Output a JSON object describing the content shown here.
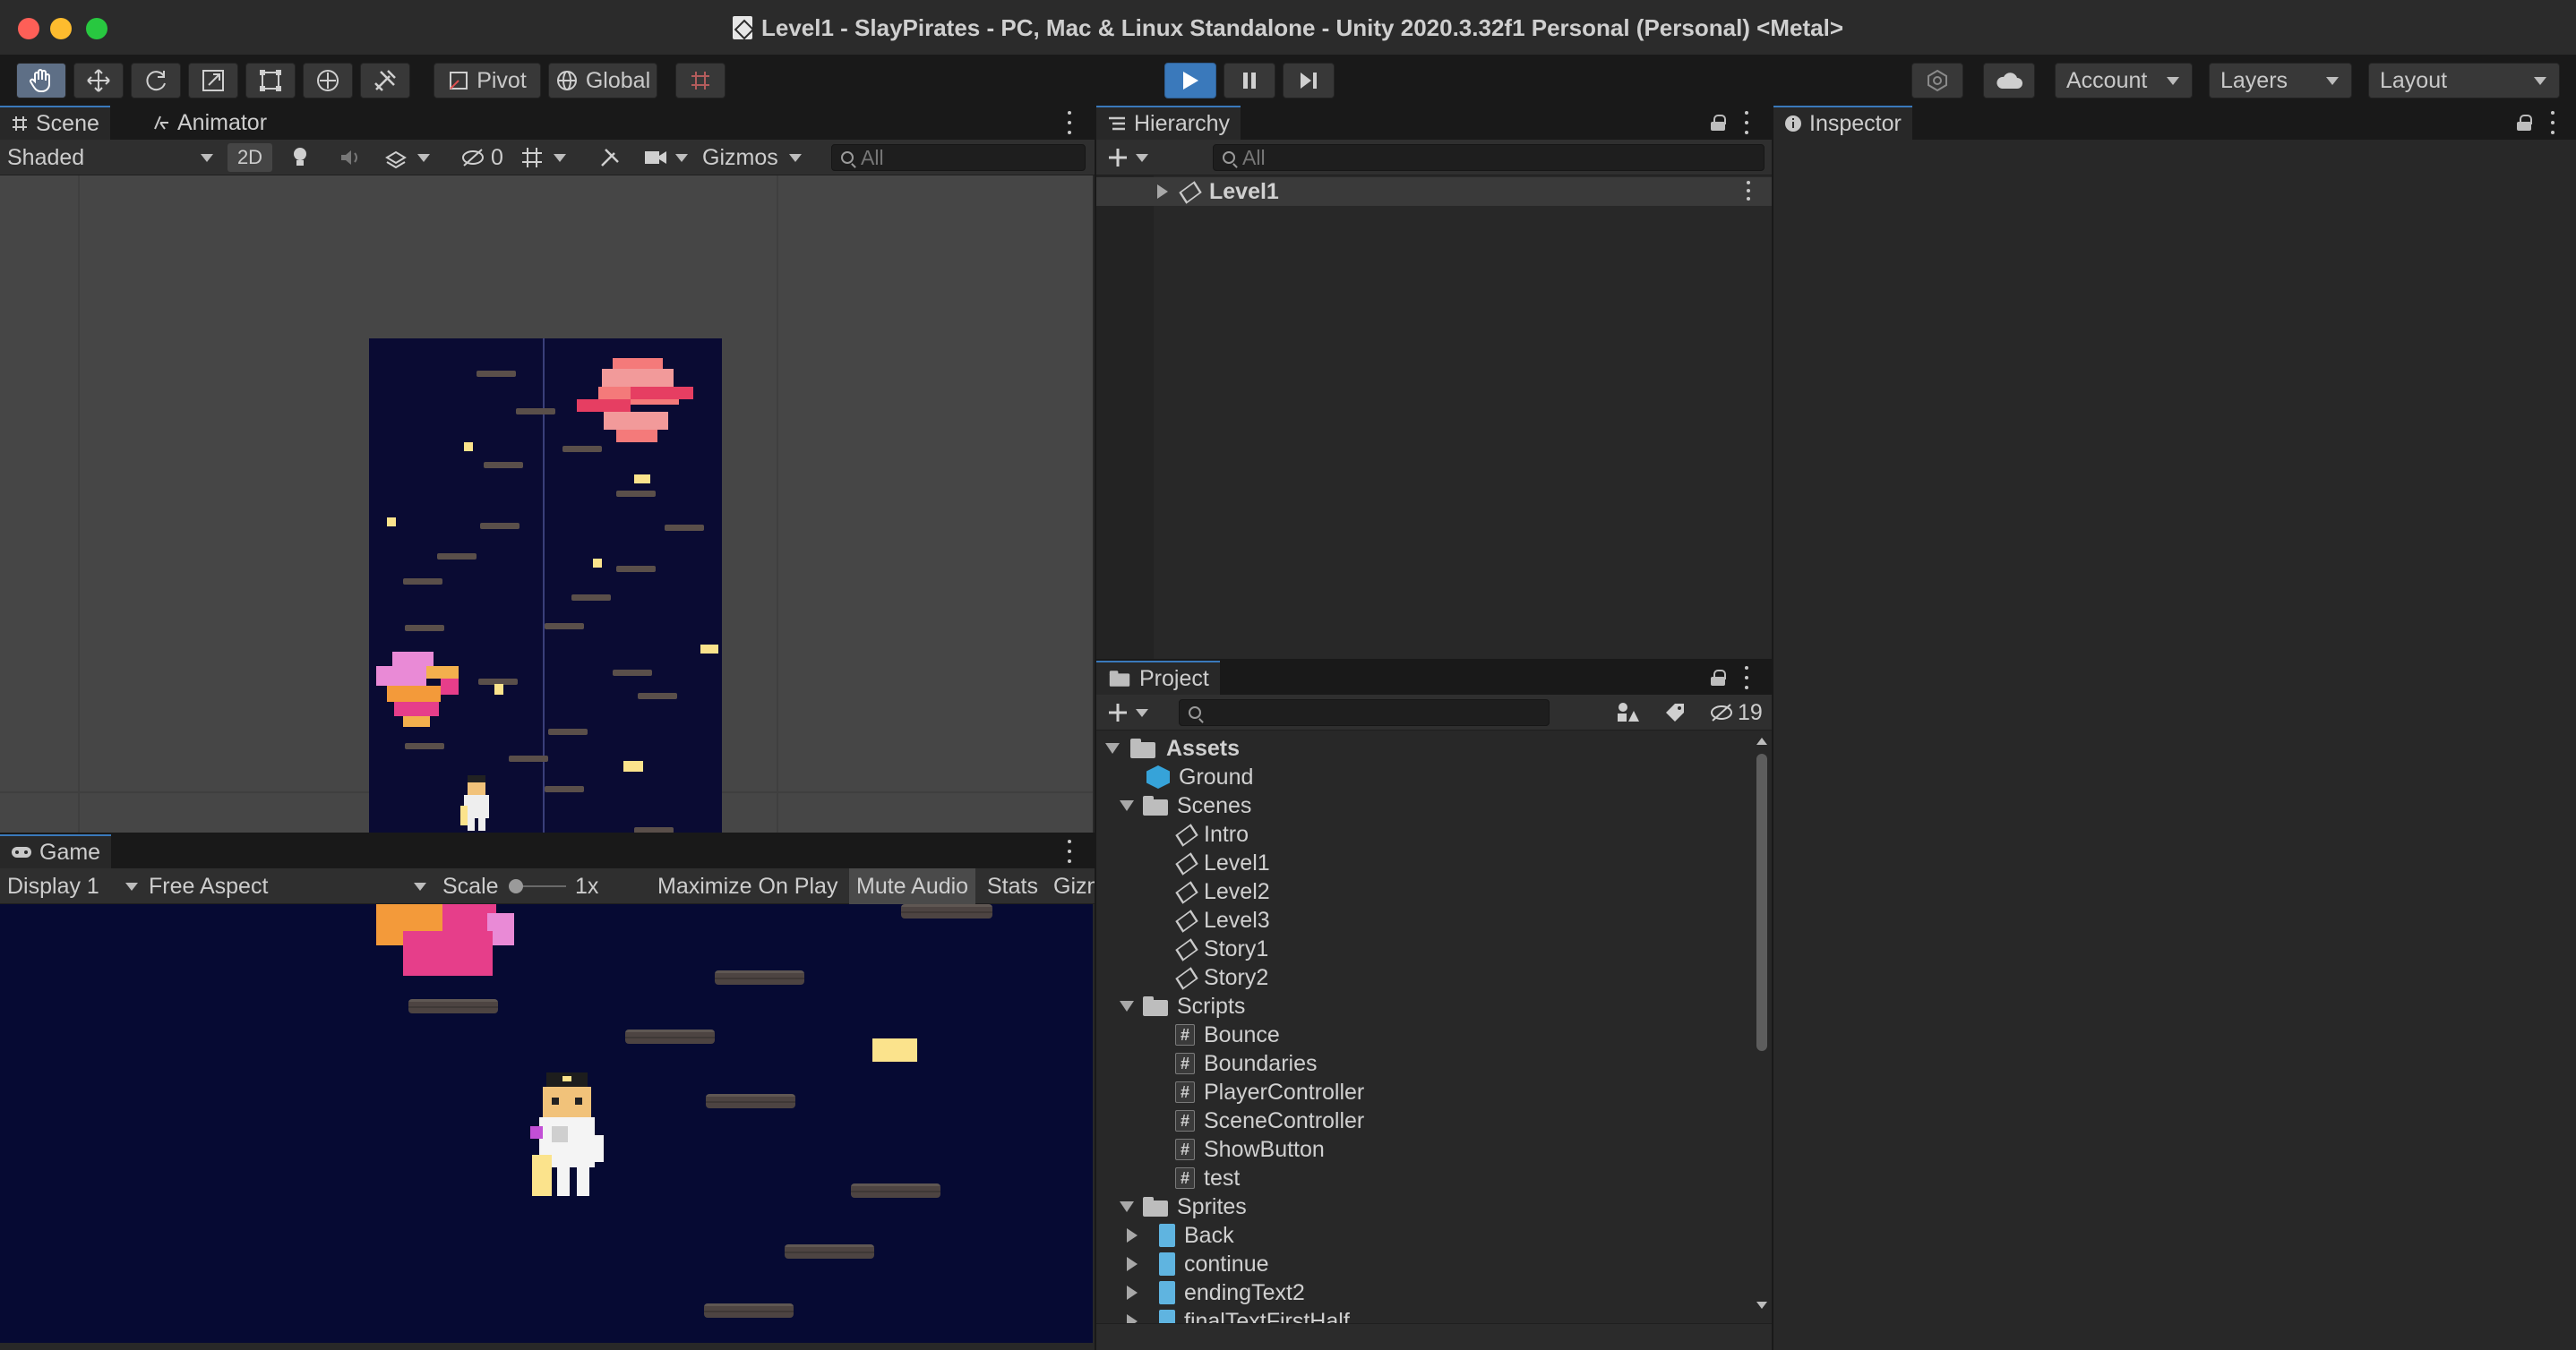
{
  "window": {
    "title": "Level1 - SlayPirates - PC, Mac & Linux Standalone - Unity 2020.3.32f1 Personal (Personal) <Metal>"
  },
  "toolbar": {
    "tools": [
      "hand-tool-icon",
      "move-tool-icon",
      "rotate-tool-icon",
      "scale-tool-icon",
      "rect-tool-icon",
      "transform-tool-icon",
      "custom-tool-icon"
    ],
    "pivot_label": "Pivot",
    "global_label": "Global",
    "account_label": "Account",
    "layers_label": "Layers",
    "layout_label": "Layout",
    "play_active_color": "#3a79bb"
  },
  "scene_panel": {
    "tab_scene": "Scene",
    "tab_animator": "Animator",
    "shading_mode": "Shaded",
    "mode_2d": "2D",
    "hidden_count": "0",
    "gizmos_label": "Gizmos",
    "search_placeholder": "All"
  },
  "game_panel": {
    "tab_game": "Game",
    "display": "Display 1",
    "aspect": "Free Aspect",
    "scale_label": "Scale",
    "scale_value": "1x",
    "maximize_label": "Maximize On Play",
    "mute_label": "Mute Audio",
    "stats_label": "Stats",
    "gizmos_label": "Gizm"
  },
  "hierarchy": {
    "tab_label": "Hierarchy",
    "search_placeholder": "All",
    "scene_root": "Level1"
  },
  "inspector": {
    "tab_label": "Inspector"
  },
  "project": {
    "tab_label": "Project",
    "hidden_count": "19",
    "root": "Assets",
    "items": [
      {
        "label": "Ground",
        "type": "prefab",
        "depth": 1
      },
      {
        "label": "Scenes",
        "type": "folder",
        "depth": 1
      },
      {
        "label": "Intro",
        "type": "scene",
        "depth": 2
      },
      {
        "label": "Level1",
        "type": "scene",
        "depth": 2
      },
      {
        "label": "Level2",
        "type": "scene",
        "depth": 2
      },
      {
        "label": "Level3",
        "type": "scene",
        "depth": 2
      },
      {
        "label": "Story1",
        "type": "scene",
        "depth": 2
      },
      {
        "label": "Story2",
        "type": "scene",
        "depth": 2
      },
      {
        "label": "Scripts",
        "type": "folder",
        "depth": 1
      },
      {
        "label": "Bounce",
        "type": "script",
        "depth": 2
      },
      {
        "label": "Boundaries",
        "type": "script",
        "depth": 2
      },
      {
        "label": "PlayerController",
        "type": "script",
        "depth": 2
      },
      {
        "label": "SceneController",
        "type": "script",
        "depth": 2
      },
      {
        "label": "ShowButton",
        "type": "script",
        "depth": 2
      },
      {
        "label": "test",
        "type": "script",
        "depth": 2
      },
      {
        "label": "Sprites",
        "type": "folder",
        "depth": 1
      },
      {
        "label": "Back",
        "type": "sprite",
        "depth": 2
      },
      {
        "label": "continue",
        "type": "sprite",
        "depth": 2
      },
      {
        "label": "endingText2",
        "type": "sprite",
        "depth": 2
      },
      {
        "label": "finalTextFirstHalf",
        "type": "sprite",
        "depth": 2
      }
    ]
  }
}
